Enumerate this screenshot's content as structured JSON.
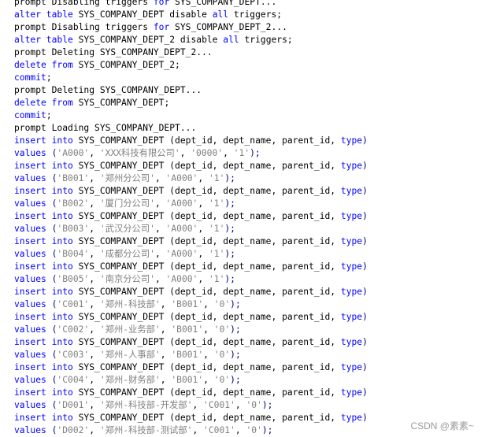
{
  "colors": {
    "keyword": "#0000ff",
    "punctuation": "#000080",
    "string": "#808080",
    "text": "#000000",
    "background": "#ffffff"
  },
  "watermark": "CSDN @素素~",
  "lines": [
    [
      {
        "t": "prompt Disabling triggers ",
        "c": "txt"
      },
      {
        "t": "for",
        "c": "kw"
      },
      {
        "t": " SYS_COMPANY_DEPT...",
        "c": "txt"
      }
    ],
    [
      {
        "t": "alter table",
        "c": "kw"
      },
      {
        "t": " SYS_COMPANY_DEPT ",
        "c": "txt"
      },
      {
        "t": "disable",
        "c": "txt"
      },
      {
        "t": " ",
        "c": "txt"
      },
      {
        "t": "all",
        "c": "kw"
      },
      {
        "t": " triggers;",
        "c": "txt"
      }
    ],
    [
      {
        "t": "prompt Disabling triggers ",
        "c": "txt"
      },
      {
        "t": "for",
        "c": "kw"
      },
      {
        "t": " SYS_COMPANY_DEPT_2...",
        "c": "txt"
      }
    ],
    [
      {
        "t": "alter table",
        "c": "kw"
      },
      {
        "t": " SYS_COMPANY_DEPT_2 ",
        "c": "txt"
      },
      {
        "t": "disable",
        "c": "txt"
      },
      {
        "t": " ",
        "c": "txt"
      },
      {
        "t": "all",
        "c": "kw"
      },
      {
        "t": " triggers;",
        "c": "txt"
      }
    ],
    [
      {
        "t": "prompt Deleting SYS_COMPANY_DEPT_2...",
        "c": "txt"
      }
    ],
    [
      {
        "t": "delete from",
        "c": "kw"
      },
      {
        "t": " SYS_COMPANY_DEPT_2;",
        "c": "txt"
      }
    ],
    [
      {
        "t": "commit",
        "c": "kw"
      },
      {
        "t": ";",
        "c": "txt"
      }
    ],
    [
      {
        "t": "prompt Deleting SYS_COMPANY_DEPT...",
        "c": "txt"
      }
    ],
    [
      {
        "t": "delete from",
        "c": "kw"
      },
      {
        "t": " SYS_COMPANY_DEPT;",
        "c": "txt"
      }
    ],
    [
      {
        "t": "commit",
        "c": "kw"
      },
      {
        "t": ";",
        "c": "txt"
      }
    ],
    [
      {
        "t": "prompt Loading SYS_COMPANY_DEPT...",
        "c": "txt"
      }
    ],
    [
      {
        "t": "insert into",
        "c": "kw"
      },
      {
        "t": " SYS_COMPANY_DEPT (dept_id, dept_name, parent_id, ",
        "c": "txt"
      },
      {
        "t": "type",
        "c": "kw"
      },
      {
        "t": ")",
        "c": "kw2"
      }
    ],
    [
      {
        "t": "values",
        "c": "kw"
      },
      {
        "t": " (",
        "c": "kw2"
      },
      {
        "t": "'A000'",
        "c": "str"
      },
      {
        "t": ", ",
        "c": "txt"
      },
      {
        "t": "'XXX科技有限公司'",
        "c": "str"
      },
      {
        "t": ", ",
        "c": "txt"
      },
      {
        "t": "'0000'",
        "c": "str"
      },
      {
        "t": ", ",
        "c": "txt"
      },
      {
        "t": "'1'",
        "c": "str"
      },
      {
        "t": ");",
        "c": "kw2"
      }
    ],
    [
      {
        "t": "insert into",
        "c": "kw"
      },
      {
        "t": " SYS_COMPANY_DEPT (dept_id, dept_name, parent_id, ",
        "c": "txt"
      },
      {
        "t": "type",
        "c": "kw"
      },
      {
        "t": ")",
        "c": "kw2"
      }
    ],
    [
      {
        "t": "values",
        "c": "kw"
      },
      {
        "t": " (",
        "c": "kw2"
      },
      {
        "t": "'B001'",
        "c": "str"
      },
      {
        "t": ", ",
        "c": "txt"
      },
      {
        "t": "'郑州分公司'",
        "c": "str"
      },
      {
        "t": ", ",
        "c": "txt"
      },
      {
        "t": "'A000'",
        "c": "str"
      },
      {
        "t": ", ",
        "c": "txt"
      },
      {
        "t": "'1'",
        "c": "str"
      },
      {
        "t": ");",
        "c": "kw2"
      }
    ],
    [
      {
        "t": "insert into",
        "c": "kw"
      },
      {
        "t": " SYS_COMPANY_DEPT (dept_id, dept_name, parent_id, ",
        "c": "txt"
      },
      {
        "t": "type",
        "c": "kw"
      },
      {
        "t": ")",
        "c": "kw2"
      }
    ],
    [
      {
        "t": "values",
        "c": "kw"
      },
      {
        "t": " (",
        "c": "kw2"
      },
      {
        "t": "'B002'",
        "c": "str"
      },
      {
        "t": ", ",
        "c": "txt"
      },
      {
        "t": "'厦门分公司'",
        "c": "str"
      },
      {
        "t": ", ",
        "c": "txt"
      },
      {
        "t": "'A000'",
        "c": "str"
      },
      {
        "t": ", ",
        "c": "txt"
      },
      {
        "t": "'1'",
        "c": "str"
      },
      {
        "t": ");",
        "c": "kw2"
      }
    ],
    [
      {
        "t": "insert into",
        "c": "kw"
      },
      {
        "t": " SYS_COMPANY_DEPT (dept_id, dept_name, parent_id, ",
        "c": "txt"
      },
      {
        "t": "type",
        "c": "kw"
      },
      {
        "t": ")",
        "c": "kw2"
      }
    ],
    [
      {
        "t": "values",
        "c": "kw"
      },
      {
        "t": " (",
        "c": "kw2"
      },
      {
        "t": "'B003'",
        "c": "str"
      },
      {
        "t": ", ",
        "c": "txt"
      },
      {
        "t": "'武汉分公司'",
        "c": "str"
      },
      {
        "t": ", ",
        "c": "txt"
      },
      {
        "t": "'A000'",
        "c": "str"
      },
      {
        "t": ", ",
        "c": "txt"
      },
      {
        "t": "'1'",
        "c": "str"
      },
      {
        "t": ");",
        "c": "kw2"
      }
    ],
    [
      {
        "t": "insert into",
        "c": "kw"
      },
      {
        "t": " SYS_COMPANY_DEPT (dept_id, dept_name, parent_id, ",
        "c": "txt"
      },
      {
        "t": "type",
        "c": "kw"
      },
      {
        "t": ")",
        "c": "kw2"
      }
    ],
    [
      {
        "t": "values",
        "c": "kw"
      },
      {
        "t": " (",
        "c": "kw2"
      },
      {
        "t": "'B004'",
        "c": "str"
      },
      {
        "t": ", ",
        "c": "txt"
      },
      {
        "t": "'成都分公司'",
        "c": "str"
      },
      {
        "t": ", ",
        "c": "txt"
      },
      {
        "t": "'A000'",
        "c": "str"
      },
      {
        "t": ", ",
        "c": "txt"
      },
      {
        "t": "'1'",
        "c": "str"
      },
      {
        "t": ");",
        "c": "kw2"
      }
    ],
    [
      {
        "t": "insert into",
        "c": "kw"
      },
      {
        "t": " SYS_COMPANY_DEPT (dept_id, dept_name, parent_id, ",
        "c": "txt"
      },
      {
        "t": "type",
        "c": "kw"
      },
      {
        "t": ")",
        "c": "kw2"
      }
    ],
    [
      {
        "t": "values",
        "c": "kw"
      },
      {
        "t": " (",
        "c": "kw2"
      },
      {
        "t": "'B005'",
        "c": "str"
      },
      {
        "t": ", ",
        "c": "txt"
      },
      {
        "t": "'南京分公司'",
        "c": "str"
      },
      {
        "t": ", ",
        "c": "txt"
      },
      {
        "t": "'A000'",
        "c": "str"
      },
      {
        "t": ", ",
        "c": "txt"
      },
      {
        "t": "'1'",
        "c": "str"
      },
      {
        "t": ");",
        "c": "kw2"
      }
    ],
    [
      {
        "t": "insert into",
        "c": "kw"
      },
      {
        "t": " SYS_COMPANY_DEPT (dept_id, dept_name, parent_id, ",
        "c": "txt"
      },
      {
        "t": "type",
        "c": "kw"
      },
      {
        "t": ")",
        "c": "kw2"
      }
    ],
    [
      {
        "t": "values",
        "c": "kw"
      },
      {
        "t": " (",
        "c": "kw2"
      },
      {
        "t": "'C001'",
        "c": "str"
      },
      {
        "t": ", ",
        "c": "txt"
      },
      {
        "t": "'郑州-科技部'",
        "c": "str"
      },
      {
        "t": ", ",
        "c": "txt"
      },
      {
        "t": "'B001'",
        "c": "str"
      },
      {
        "t": ", ",
        "c": "txt"
      },
      {
        "t": "'0'",
        "c": "str"
      },
      {
        "t": ");",
        "c": "kw2"
      }
    ],
    [
      {
        "t": "insert into",
        "c": "kw"
      },
      {
        "t": " SYS_COMPANY_DEPT (dept_id, dept_name, parent_id, ",
        "c": "txt"
      },
      {
        "t": "type",
        "c": "kw"
      },
      {
        "t": ")",
        "c": "kw2"
      }
    ],
    [
      {
        "t": "values",
        "c": "kw"
      },
      {
        "t": " (",
        "c": "kw2"
      },
      {
        "t": "'C002'",
        "c": "str"
      },
      {
        "t": ", ",
        "c": "txt"
      },
      {
        "t": "'郑州-业务部'",
        "c": "str"
      },
      {
        "t": ", ",
        "c": "txt"
      },
      {
        "t": "'B001'",
        "c": "str"
      },
      {
        "t": ", ",
        "c": "txt"
      },
      {
        "t": "'0'",
        "c": "str"
      },
      {
        "t": ");",
        "c": "kw2"
      }
    ],
    [
      {
        "t": "insert into",
        "c": "kw"
      },
      {
        "t": " SYS_COMPANY_DEPT (dept_id, dept_name, parent_id, ",
        "c": "txt"
      },
      {
        "t": "type",
        "c": "kw"
      },
      {
        "t": ")",
        "c": "kw2"
      }
    ],
    [
      {
        "t": "values",
        "c": "kw"
      },
      {
        "t": " (",
        "c": "kw2"
      },
      {
        "t": "'C003'",
        "c": "str"
      },
      {
        "t": ", ",
        "c": "txt"
      },
      {
        "t": "'郑州-人事部'",
        "c": "str"
      },
      {
        "t": ", ",
        "c": "txt"
      },
      {
        "t": "'B001'",
        "c": "str"
      },
      {
        "t": ", ",
        "c": "txt"
      },
      {
        "t": "'0'",
        "c": "str"
      },
      {
        "t": ");",
        "c": "kw2"
      }
    ],
    [
      {
        "t": "insert into",
        "c": "kw"
      },
      {
        "t": " SYS_COMPANY_DEPT (dept_id, dept_name, parent_id, ",
        "c": "txt"
      },
      {
        "t": "type",
        "c": "kw"
      },
      {
        "t": ")",
        "c": "kw2"
      }
    ],
    [
      {
        "t": "values",
        "c": "kw"
      },
      {
        "t": " (",
        "c": "kw2"
      },
      {
        "t": "'C004'",
        "c": "str"
      },
      {
        "t": ", ",
        "c": "txt"
      },
      {
        "t": "'郑州-财务部'",
        "c": "str"
      },
      {
        "t": ", ",
        "c": "txt"
      },
      {
        "t": "'B001'",
        "c": "str"
      },
      {
        "t": ", ",
        "c": "txt"
      },
      {
        "t": "'0'",
        "c": "str"
      },
      {
        "t": ");",
        "c": "kw2"
      }
    ],
    [
      {
        "t": "insert into",
        "c": "kw"
      },
      {
        "t": " SYS_COMPANY_DEPT (dept_id, dept_name, parent_id, ",
        "c": "txt"
      },
      {
        "t": "type",
        "c": "kw"
      },
      {
        "t": ")",
        "c": "kw2"
      }
    ],
    [
      {
        "t": "values",
        "c": "kw"
      },
      {
        "t": " (",
        "c": "kw2"
      },
      {
        "t": "'D001'",
        "c": "str"
      },
      {
        "t": ", ",
        "c": "txt"
      },
      {
        "t": "'郑州-科技部-开发部'",
        "c": "str"
      },
      {
        "t": ", ",
        "c": "txt"
      },
      {
        "t": "'C001'",
        "c": "str"
      },
      {
        "t": ", ",
        "c": "txt"
      },
      {
        "t": "'0'",
        "c": "str"
      },
      {
        "t": ");",
        "c": "kw2"
      }
    ],
    [
      {
        "t": "insert into",
        "c": "kw"
      },
      {
        "t": " SYS_COMPANY_DEPT (dept_id, dept_name, parent_id, ",
        "c": "txt"
      },
      {
        "t": "type",
        "c": "kw"
      },
      {
        "t": ")",
        "c": "kw2"
      }
    ],
    [
      {
        "t": "values",
        "c": "kw"
      },
      {
        "t": " (",
        "c": "kw2"
      },
      {
        "t": "'D002'",
        "c": "str"
      },
      {
        "t": ", ",
        "c": "txt"
      },
      {
        "t": "'郑州-科技部-测试部'",
        "c": "str"
      },
      {
        "t": ", ",
        "c": "txt"
      },
      {
        "t": "'C001'",
        "c": "str"
      },
      {
        "t": ", ",
        "c": "txt"
      },
      {
        "t": "'0'",
        "c": "str"
      },
      {
        "t": ");",
        "c": "kw2"
      }
    ]
  ]
}
